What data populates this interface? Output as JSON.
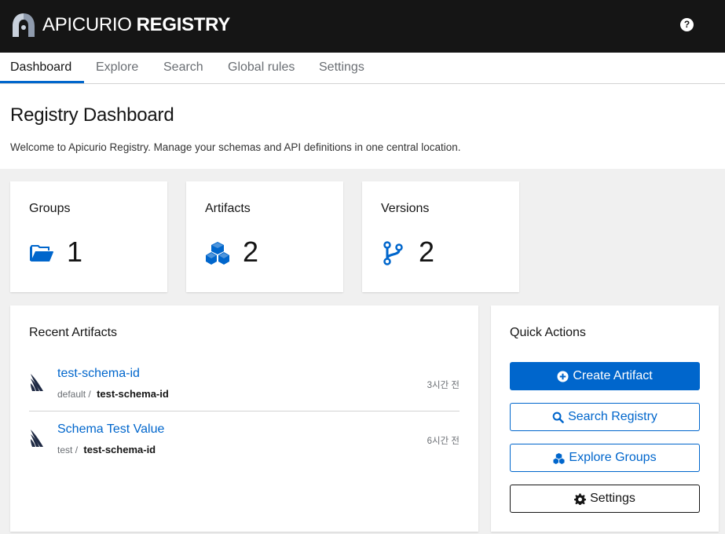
{
  "header": {
    "brand_light": "APICURIO",
    "brand_bold": "REGISTRY",
    "help_icon": "question-circle-icon",
    "help_glyph": "?"
  },
  "tabs": [
    {
      "label": "Dashboard",
      "active": true
    },
    {
      "label": "Explore",
      "active": false
    },
    {
      "label": "Search",
      "active": false
    },
    {
      "label": "Global rules",
      "active": false
    },
    {
      "label": "Settings",
      "active": false
    }
  ],
  "page": {
    "title": "Registry Dashboard",
    "description": "Welcome to Apicurio Registry. Manage your schemas and API definitions in one central location."
  },
  "stats": [
    {
      "label": "Groups",
      "value": "1",
      "icon": "folder-open-icon"
    },
    {
      "label": "Artifacts",
      "value": "2",
      "icon": "cubes-icon"
    },
    {
      "label": "Versions",
      "value": "2",
      "icon": "code-branch-icon"
    }
  ],
  "recent": {
    "title": "Recent Artifacts",
    "items": [
      {
        "name": "test-schema-id",
        "group": "default",
        "sep": "/",
        "id": "test-schema-id",
        "time": "3시간 전",
        "icon": "avro-wing-icon"
      },
      {
        "name": "Schema Test Value",
        "group": "test",
        "sep": "/",
        "id": "test-schema-id",
        "time": "6시간 전",
        "icon": "avro-wing-icon"
      }
    ]
  },
  "quick_actions": {
    "title": "Quick Actions",
    "buttons": [
      {
        "label": "Create Artifact",
        "icon": "plus-circle-icon"
      },
      {
        "label": "Search Registry",
        "icon": "search-icon"
      },
      {
        "label": "Explore Groups",
        "icon": "cubes-icon"
      },
      {
        "label": "Settings",
        "icon": "gear-icon"
      }
    ]
  },
  "colors": {
    "accent": "#0066cc",
    "header_bg": "#151515",
    "page_bg": "#f0f0f0"
  }
}
